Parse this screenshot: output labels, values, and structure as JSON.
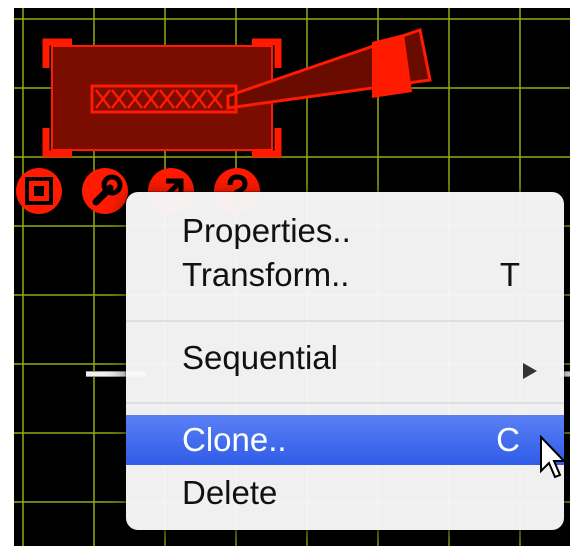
{
  "canvas": {
    "grid_color": "#9aaa14",
    "background": "#000000",
    "object_color": "#ff1a00"
  },
  "object_icons": [
    "select-icon",
    "wrench-icon",
    "arrow-icon",
    "help-icon"
  ],
  "menu": {
    "items": [
      {
        "label": "Properties..",
        "shortcut": ""
      },
      {
        "label": "Transform..",
        "shortcut": "T"
      },
      {
        "label": "Sequential",
        "submenu": true
      },
      {
        "label": "Clone..",
        "shortcut": "C",
        "highlighted": true
      },
      {
        "label": "Delete",
        "shortcut": ""
      }
    ],
    "highlight_color": "#3b66ee"
  }
}
